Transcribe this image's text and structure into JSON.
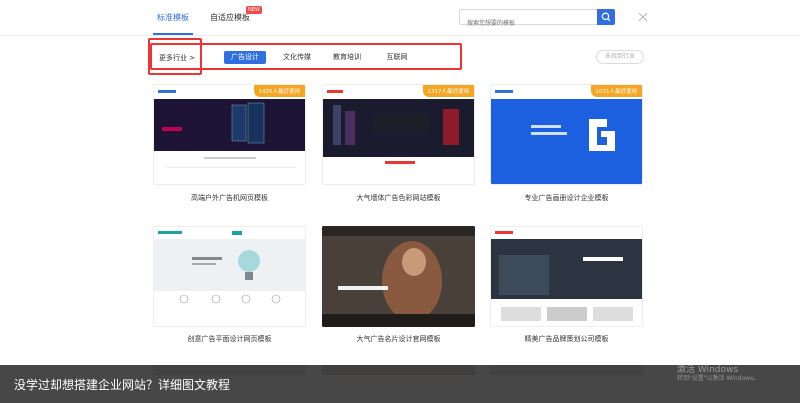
{
  "tabs": [
    {
      "label": "标准模板"
    },
    {
      "label": "自适应模板",
      "badge": "NEW"
    }
  ],
  "search": {
    "placeholder": "搜索您想要的模板"
  },
  "filter": {
    "industry_label": "更多行业 >",
    "chips": [
      "广告设计",
      "文化传媒",
      "教育培训",
      "互联网"
    ],
    "active_chip": "广告设计",
    "unsorted_label": "未找到行业"
  },
  "cards": [
    {
      "caption": "高端户外广告机网页模板",
      "badge": "1425人最近使用",
      "hero_text": "智慧品牌户外广告机 高清广告机+OTS品质"
    },
    {
      "caption": "大气墙体广告色彩网站模板",
      "badge": "1317人最近使用",
      "hero_text": "让世界看到你的价值",
      "stats": [
        "200",
        "1526",
        "432"
      ]
    },
    {
      "caption": "专业广告画册设计企业模板",
      "badge": "1021人最近使用",
      "hero_text": "Creative Design 品牌管理·创意设计"
    },
    {
      "caption": "创意广告平面设计网页模板",
      "hero_text": "CREATIVE 让创意飞翔"
    },
    {
      "caption": "大气广告名片设计官网模板",
      "hero_text": "ADVERTISING CREATIVITY"
    },
    {
      "caption": "精美广告品牌策划公司模板",
      "hero_text": "广告·策划"
    }
  ],
  "overlay": {
    "text": "没学过却想搭建企业网站？详细图文教程",
    "watermark_title": "激活 Windows",
    "watermark_sub": "转到\"设置\"以激活 Windows。"
  },
  "colors": {
    "accent": "#2f6fe0",
    "highlight": "#e33333",
    "badge": "#f5a623"
  }
}
